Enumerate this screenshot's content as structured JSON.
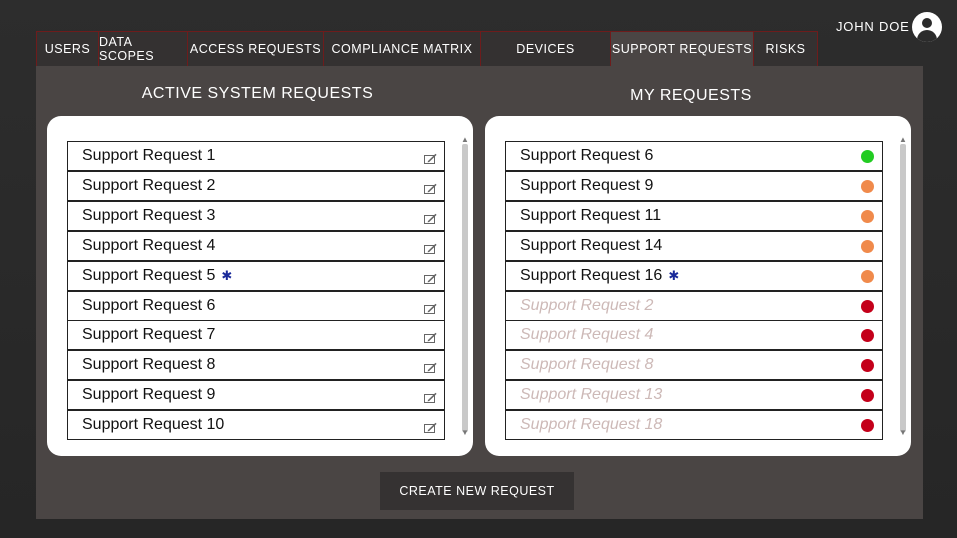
{
  "user": {
    "name": "JOHN DOE",
    "avatar_icon": "user-avatar-icon"
  },
  "tabs": [
    {
      "label": "USERS",
      "active": false
    },
    {
      "label": "DATA SCOPES",
      "active": false
    },
    {
      "label": "ACCESS REQUESTS",
      "active": false
    },
    {
      "label": "COMPLIANCE MATRIX",
      "active": false
    },
    {
      "label": "DEVICES",
      "active": false
    },
    {
      "label": "SUPPORT REQUESTS",
      "active": true
    },
    {
      "label": "RISKS",
      "active": false
    }
  ],
  "active_requests": {
    "title": "ACTIVE SYSTEM REQUESTS",
    "items": [
      {
        "label": "Support Request 1",
        "flagged": false
      },
      {
        "label": "Support Request 2",
        "flagged": false
      },
      {
        "label": "Support Request 3",
        "flagged": false
      },
      {
        "label": "Support Request 4",
        "flagged": false
      },
      {
        "label": "Support Request 5",
        "flagged": true
      },
      {
        "label": "Support Request 6",
        "flagged": false
      },
      {
        "label": "Support Request 7",
        "flagged": false
      },
      {
        "label": "Support Request 8",
        "flagged": false
      },
      {
        "label": "Support Request 9",
        "flagged": false
      },
      {
        "label": "Support Request 10",
        "flagged": false
      }
    ]
  },
  "my_requests": {
    "title": "MY REQUESTS",
    "items": [
      {
        "label": "Support Request 6",
        "flagged": false,
        "status": "green",
        "faded": false
      },
      {
        "label": "Support Request 9",
        "flagged": false,
        "status": "orange",
        "faded": false
      },
      {
        "label": "Support Request 11",
        "flagged": false,
        "status": "orange",
        "faded": false
      },
      {
        "label": "Support Request 14",
        "flagged": false,
        "status": "orange",
        "faded": false
      },
      {
        "label": "Support Request 16",
        "flagged": true,
        "status": "orange",
        "faded": false
      },
      {
        "label": "Support Request 2",
        "flagged": false,
        "status": "red",
        "faded": true
      },
      {
        "label": "Support Request 4",
        "flagged": false,
        "status": "red",
        "faded": true
      },
      {
        "label": "Support Request 8",
        "flagged": false,
        "status": "red",
        "faded": true
      },
      {
        "label": "Support Request 13",
        "flagged": false,
        "status": "red",
        "faded": true
      },
      {
        "label": "Support Request 18",
        "flagged": false,
        "status": "red",
        "faded": true
      }
    ]
  },
  "flag_glyph": "✱",
  "status_colors": {
    "green": "#22cc22",
    "orange": "#f08a4b",
    "red": "#c4001a"
  },
  "create_button": {
    "label": "CREATE NEW REQUEST"
  }
}
